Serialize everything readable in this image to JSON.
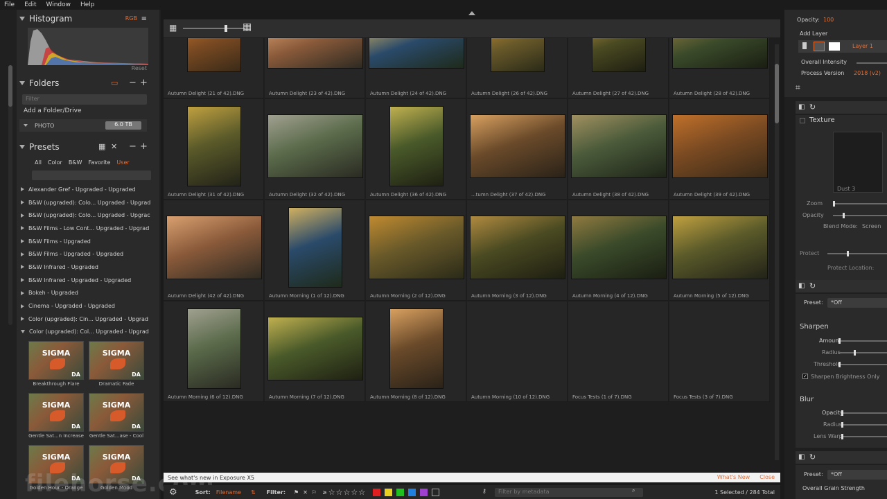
{
  "menu": [
    "File",
    "Edit",
    "Window",
    "Help"
  ],
  "histogram": {
    "title": "Histogram",
    "channel": "RGB",
    "reset": "Reset"
  },
  "folders": {
    "title": "Folders",
    "filter_placeholder": "Filter",
    "add": "Add a Folder/Drive",
    "drive": "PHOTO",
    "drive_size": "6.0 TB"
  },
  "presets": {
    "title": "Presets",
    "tabs": [
      "All",
      "Color",
      "B&W",
      "Favorite",
      "User"
    ],
    "items": [
      "Alexander Gref - Upgraded - Upgraded",
      "B&W (upgraded): Colo... Upgraded - Upgrad",
      "B&W (upgraded): Colo... Upgraded - Upgrac",
      "B&W Films - Low Cont... Upgraded - Upgrad",
      "B&W Films - Upgraded",
      "B&W Films - Upgraded - Upgraded",
      "B&W Infrared - Upgraded",
      "B&W Infrared - Upgraded - Upgraded",
      "Bokeh - Upgraded",
      "Cinema - Upgraded - Upgraded",
      "Color (upgraded): Cin... Upgraded - Upgrad",
      "Color (upgraded): Col... Upgraded - Upgrad"
    ],
    "thumb_brand": "SIGMA",
    "thumb_tag": "DA",
    "thumbs": [
      "Breakthrough Flare",
      "Dramatic Fade",
      "Gentle Sat...n Increase",
      "Gentle Sat...ase - Cool",
      "Golden Hour - Orange",
      "Golden Mood"
    ]
  },
  "watermark": "filehorse.com",
  "grid": {
    "captions": [
      "Autumn Delight (21 of 42).DNG",
      "Autumn Delight (23 of 42).DNG",
      "Autumn Delight (24 of 42).DNG",
      "Autumn Delight (26 of 42).DNG",
      "Autumn Delight (27 of 42).DNG",
      "Autumn Delight (28 of 42).DNG",
      "Autumn Delight (31 of 42).DNG",
      "Autumn Delight (32 of 42).DNG",
      "Autumn Delight (36 of 42).DNG",
      "...tumn Delight (37 of 42).DNG",
      "Autumn Delight (38 of 42).DNG",
      "Autumn Delight (39 of 42).DNG",
      "Autumn Delight (42 of 42).DNG",
      "Autumn Morning (1 of 12).DNG",
      "Autumn Morning (2 of 12).DNG",
      "Autumn Morning (3 of 12).DNG",
      "Autumn Morning (4 of 12).DNG",
      "Autumn Morning (5 of 12).DNG",
      "Autumn Morning (6 of 12).DNG",
      "Autumn Morning (7 of 12).DNG",
      "Autumn Morning (8 of 12).DNG",
      "Autumn Morning (10 of 12).DNG",
      "Focus Tests (1 of 7).DNG",
      "Focus Tests (3 of 7).DNG"
    ],
    "rating": "☆☆☆☆☆"
  },
  "notice": {
    "text": "See what's new in Exposure X5",
    "whats_new": "What's New",
    "close": "Close"
  },
  "bottom": {
    "sort_label": "Sort:",
    "sort_value": "Filename",
    "filter_label": "Filter:",
    "rating_prefix": "≥",
    "stars": "☆☆☆☆☆",
    "colors": [
      "#e02020",
      "#e8d020",
      "#20c020",
      "#2080e0",
      "#a040d0"
    ],
    "meta_placeholder": "Filter by metadata",
    "status": "1 Selected / 284 Total"
  },
  "right": {
    "opacity_label": "Opacity:",
    "opacity_value": "100",
    "add_layer": "Add Layer",
    "layer_name": "Layer 1",
    "overall_intensity": "Overall Intensity",
    "process_version": "Process Version",
    "process_value": "2018 (v2)",
    "texture": {
      "title": "Texture",
      "dust": "Dust 3",
      "zoom": "Zoom",
      "opacity": "Opacity",
      "blend": "Blend Mode:",
      "blend_value": "Screen",
      "protect": "Protect",
      "protect_loc": "Protect Location:"
    },
    "sharpen": {
      "preset_label": "Preset:",
      "preset_value": "*Off",
      "title": "Sharpen",
      "amount": "Amount",
      "radius": "Radius",
      "threshold": "Threshold",
      "brightness": "Sharpen Brightness Only"
    },
    "blur": {
      "title": "Blur",
      "opacity": "Opacity",
      "radius": "Radius",
      "lens_warp": "Lens Warp"
    },
    "grain": {
      "preset_label": "Preset:",
      "preset_value": "*Off",
      "overall": "Overall Grain Strength"
    }
  }
}
